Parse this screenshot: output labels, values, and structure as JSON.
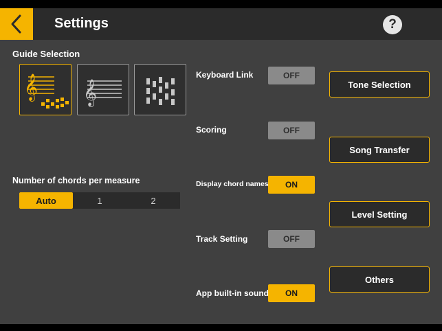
{
  "header": {
    "title": "Settings",
    "back_icon": "chevron-left-icon",
    "help_label": "?"
  },
  "guide_selection": {
    "label": "Guide Selection",
    "options": [
      {
        "icon": "score-with-blocks-icon",
        "selected": true
      },
      {
        "icon": "score-icon",
        "selected": false
      },
      {
        "icon": "falling-blocks-icon",
        "selected": false
      }
    ]
  },
  "chords": {
    "label": "Number of chords per measure",
    "options": [
      "Auto",
      "1",
      "2"
    ],
    "selected": "Auto"
  },
  "toggles": [
    {
      "label": "Keyboard Link",
      "state": "OFF"
    },
    {
      "label": "Scoring",
      "state": "OFF"
    },
    {
      "label": "Display chord names",
      "state": "ON"
    },
    {
      "label": "Track Setting",
      "state": "OFF"
    },
    {
      "label": "App built-in sound",
      "state": "ON"
    }
  ],
  "actions": [
    "Tone Selection",
    "Song Transfer",
    "Level Setting",
    "Others"
  ],
  "colors": {
    "accent": "#f5b400",
    "header_bg": "#2b2b2b",
    "content_bg": "#404040",
    "toggle_off": "#8a8a8a"
  }
}
